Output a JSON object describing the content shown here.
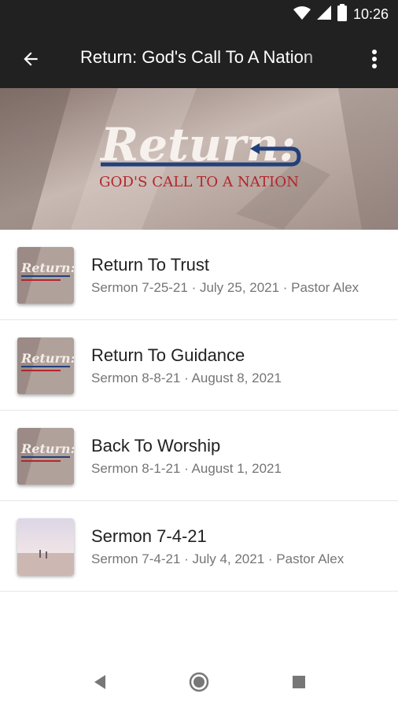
{
  "status_bar": {
    "time": "10:26",
    "icons": [
      "wifi-icon",
      "cell-signal-icon",
      "battery-icon"
    ]
  },
  "toolbar": {
    "title": "Return: God's Call To A Nation",
    "back_icon": "arrow-back-icon",
    "menu_icon": "more-vert-icon"
  },
  "hero": {
    "logo_word": "Return:",
    "tagline": "GOD'S CALL TO A NATION"
  },
  "sermons": [
    {
      "title": "Return To Trust",
      "subtitle": "Sermon 7-25-21 · July 25, 2021 · Pastor Alex",
      "thumb": "series"
    },
    {
      "title": "Return To Guidance",
      "subtitle": "Sermon 8-8-21 · August 8, 2021",
      "thumb": "series"
    },
    {
      "title": "Back To Worship",
      "subtitle": "Sermon 8-1-21 · August 1, 2021",
      "thumb": "series"
    },
    {
      "title": "Sermon 7-4-21",
      "subtitle": "Sermon 7-4-21 · July 4, 2021 · Pastor Alex",
      "thumb": "beach"
    }
  ],
  "nav_bar": {
    "icons": [
      "nav-back-icon",
      "nav-home-icon",
      "nav-recents-icon"
    ]
  },
  "colors": {
    "app_bar": "#212121",
    "accent_red": "#b3262c",
    "accent_blue": "#22407a",
    "title_text": "#212121",
    "subtitle_text": "#757575"
  }
}
